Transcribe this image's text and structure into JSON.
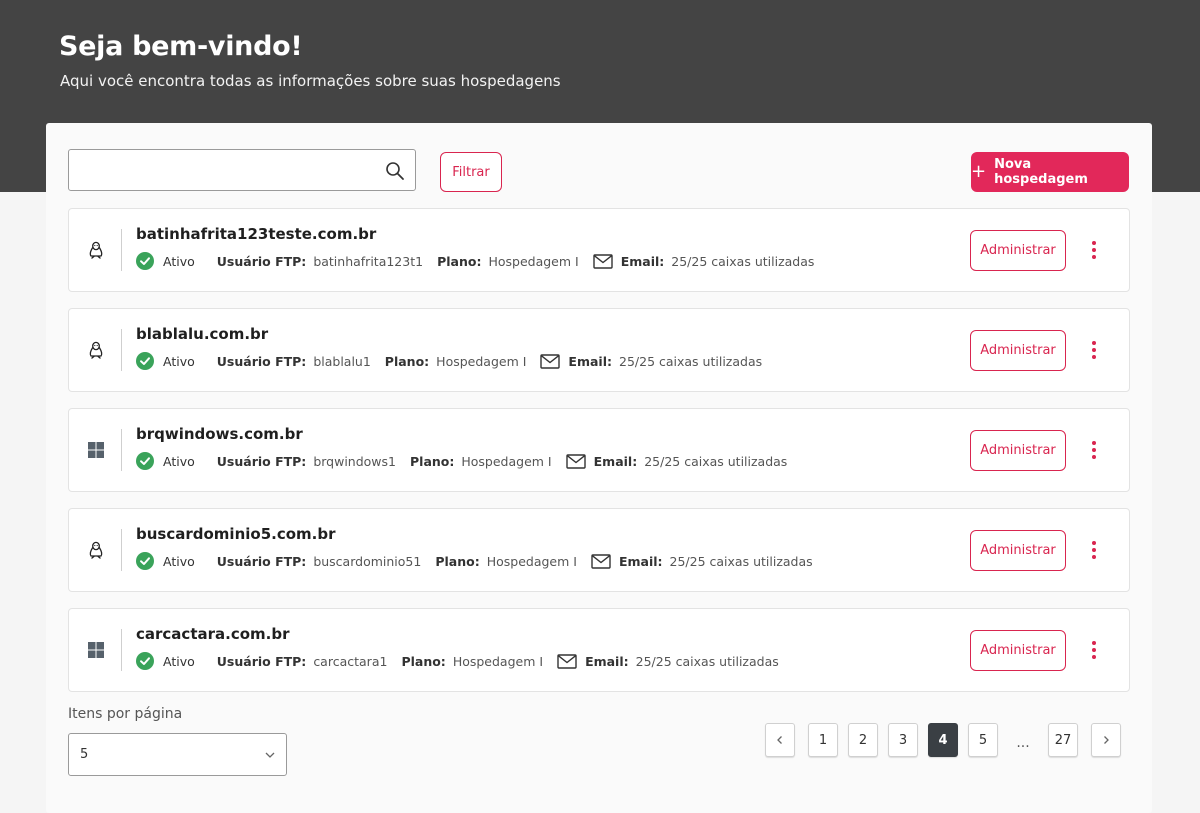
{
  "header": {
    "title": "Seja bem-vindo!",
    "subtitle": "Aqui você encontra todas as informações sobre suas hospedagens"
  },
  "toolbar": {
    "search_value": "",
    "search_icon": "search-icon",
    "filter_label": "Filtrar",
    "new_label": "Nova hospedagem",
    "new_icon": "plus-icon"
  },
  "colors": {
    "accent": "#e2285a",
    "header_bg": "#444444",
    "status_ok": "#3aa35a",
    "pager_active": "#3a3f44"
  },
  "labels": {
    "ftp": "Usuário FTP:",
    "plano": "Plano:",
    "email": "Email:",
    "admin": "Administrar"
  },
  "hostings": [
    {
      "os": "linux",
      "os_icon": "linux-icon",
      "domain": "batinhafrita123teste.com.br",
      "status": "Ativo",
      "ftp_user": "batinhafrita123t1",
      "plan": "Hospedagem I",
      "email_usage": "25/25 caixas utilizadas"
    },
    {
      "os": "linux",
      "os_icon": "linux-icon",
      "domain": "blablalu.com.br",
      "status": "Ativo",
      "ftp_user": "blablalu1",
      "plan": "Hospedagem I",
      "email_usage": "25/25 caixas utilizadas"
    },
    {
      "os": "windows",
      "os_icon": "windows-icon",
      "domain": "brqwindows.com.br",
      "status": "Ativo",
      "ftp_user": "brqwindows1",
      "plan": "Hospedagem I",
      "email_usage": "25/25 caixas utilizadas"
    },
    {
      "os": "linux",
      "os_icon": "linux-icon",
      "domain": "buscardominio5.com.br",
      "status": "Ativo",
      "ftp_user": "buscardominio51",
      "plan": "Hospedagem I",
      "email_usage": "25/25 caixas utilizadas"
    },
    {
      "os": "windows",
      "os_icon": "windows-icon",
      "domain": "carcactara.com.br",
      "status": "Ativo",
      "ftp_user": "carcactara1",
      "plan": "Hospedagem I",
      "email_usage": "25/25 caixas utilizadas"
    }
  ],
  "pagination": {
    "per_page_label": "Itens por página",
    "per_page_value": "5",
    "pages": [
      "1",
      "2",
      "3",
      "4",
      "5",
      "27"
    ],
    "current": "4",
    "ellipsis": "..."
  }
}
